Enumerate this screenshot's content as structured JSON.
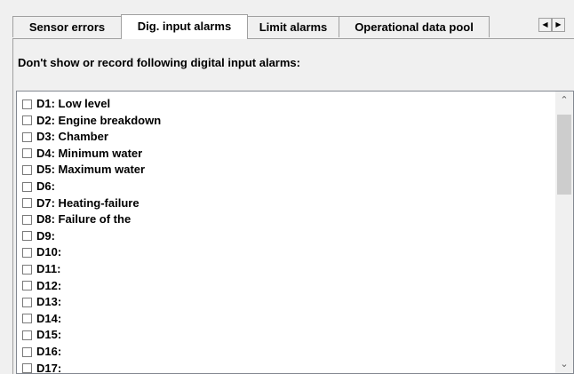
{
  "tabs": [
    {
      "label": "Sensor errors",
      "active": false
    },
    {
      "label": "Dig. input alarms",
      "active": true
    },
    {
      "label": "Limit alarms",
      "active": false
    },
    {
      "label": "Operational data pool",
      "active": false
    }
  ],
  "tab_scroll": {
    "left_icon": "◀",
    "right_icon": "▶"
  },
  "caption": "Don't show or record following digital input alarms:",
  "alarm_items": [
    {
      "label": "D1: Low level",
      "checked": false
    },
    {
      "label": "D2: Engine breakdown",
      "checked": false
    },
    {
      "label": "D3: Chamber",
      "checked": false
    },
    {
      "label": "D4: Minimum water",
      "checked": false
    },
    {
      "label": "D5: Maximum water",
      "checked": false
    },
    {
      "label": "D6:",
      "checked": false
    },
    {
      "label": "D7: Heating-failure",
      "checked": false
    },
    {
      "label": "D8: Failure of the",
      "checked": false
    },
    {
      "label": "D9:",
      "checked": false
    },
    {
      "label": "D10:",
      "checked": false
    },
    {
      "label": "D11:",
      "checked": false
    },
    {
      "label": "D12:",
      "checked": false
    },
    {
      "label": "D13:",
      "checked": false
    },
    {
      "label": "D14:",
      "checked": false
    },
    {
      "label": "D15:",
      "checked": false
    },
    {
      "label": "D16:",
      "checked": false
    },
    {
      "label": "D17:",
      "checked": false
    }
  ],
  "scrollbar": {
    "up_icon": "⌃",
    "down_icon": "⌄"
  }
}
